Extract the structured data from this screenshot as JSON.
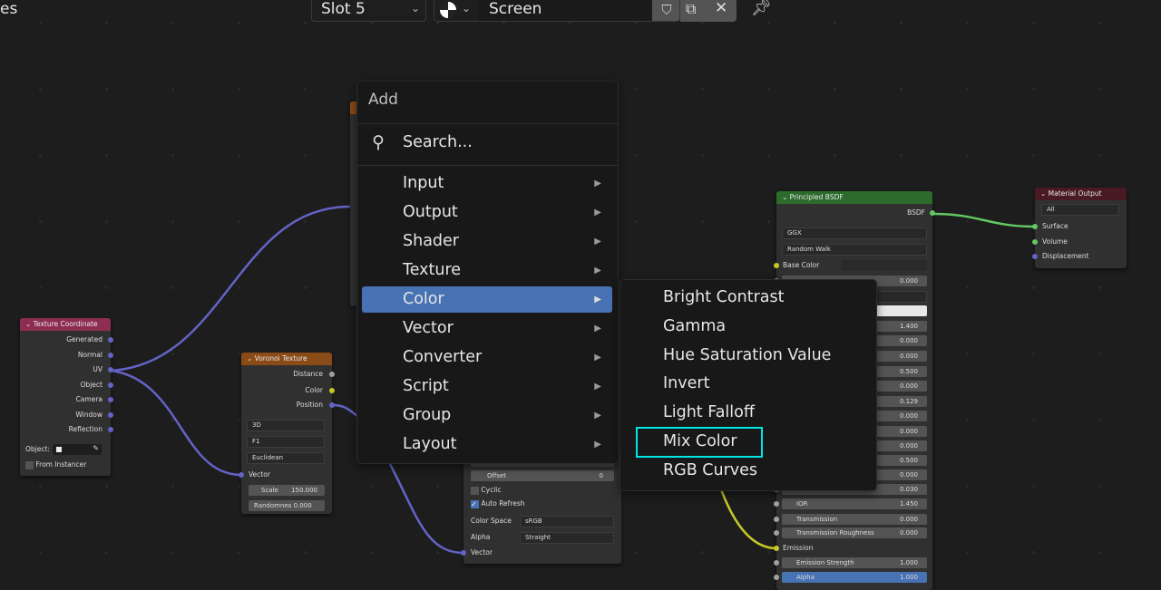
{
  "topbar": {
    "left_text": "es",
    "slot": "Slot 5",
    "material_name": "Screen",
    "icons": [
      "shield-icon",
      "copy-icon",
      "close-icon",
      "pin-icon"
    ]
  },
  "colors": {
    "accent": "#4772b3",
    "highlight_outline": "#00e5e5",
    "link_vector": "#6363c7",
    "link_color": "#c7c729",
    "link_shader": "#63c763"
  },
  "add_menu": {
    "title": "Add",
    "search": "Search...",
    "items": [
      "Input",
      "Output",
      "Shader",
      "Texture",
      "Color",
      "Vector",
      "Converter",
      "Script",
      "Group",
      "Layout"
    ],
    "active": "Color"
  },
  "color_submenu": {
    "items": [
      "Bright Contrast",
      "Gamma",
      "Hue Saturation Value",
      "Invert",
      "Light Falloff",
      "Mix Color",
      "RGB Curves"
    ],
    "highlighted": "Mix Color"
  },
  "texture_coordinate": {
    "title": "Texture Coordinate",
    "outputs": [
      "Generated",
      "Normal",
      "UV",
      "Object",
      "Camera",
      "Window",
      "Reflection"
    ],
    "object_label": "Object:",
    "from_instancer": "From Instancer"
  },
  "voronoi": {
    "title": "Voronoi Texture",
    "outputs": [
      "Distance",
      "Color",
      "Position"
    ],
    "dims": "3D",
    "feature": "F1",
    "metric": "Euclidean",
    "vector": "Vector",
    "scale_label": "Scale",
    "scale": "150.000",
    "randomness_label": "Randomnes",
    "randomness": "0.000"
  },
  "image_texture": {
    "offset_label": "Offset",
    "offset": "0",
    "cyclic": "Cyclic",
    "auto_refresh": "Auto Refresh",
    "auto_refresh_checked": true,
    "color_space_label": "Color Space",
    "color_space": "sRGB",
    "alpha_label": "Alpha",
    "alpha": "Straight",
    "vector": "Vector"
  },
  "principled": {
    "title": "Principled BSDF",
    "output": "BSDF",
    "distribution": "GGX",
    "subsurface_method": "Random Walk",
    "base_color": "Base Color",
    "values": [
      "0.000",
      "1.400",
      "0.000",
      "0.000",
      "0.500",
      "0.000",
      "0.129",
      "0.000",
      "0.000",
      "0.000",
      "0.500",
      "0.000",
      "0.030"
    ],
    "ior_label": "IOR",
    "ior": "1.450",
    "transmission_label": "Transmission",
    "transmission": "0.000",
    "trans_rough_label": "Transmission Roughness",
    "trans_rough": "0.000",
    "emission": "Emission",
    "emission_strength_label": "Emission Strength",
    "emission_strength": "1.000",
    "alpha_label": "Alpha",
    "alpha": "1.000"
  },
  "material_output": {
    "title": "Material Output",
    "target": "All",
    "inputs": [
      "Surface",
      "Volume",
      "Displacement"
    ]
  }
}
